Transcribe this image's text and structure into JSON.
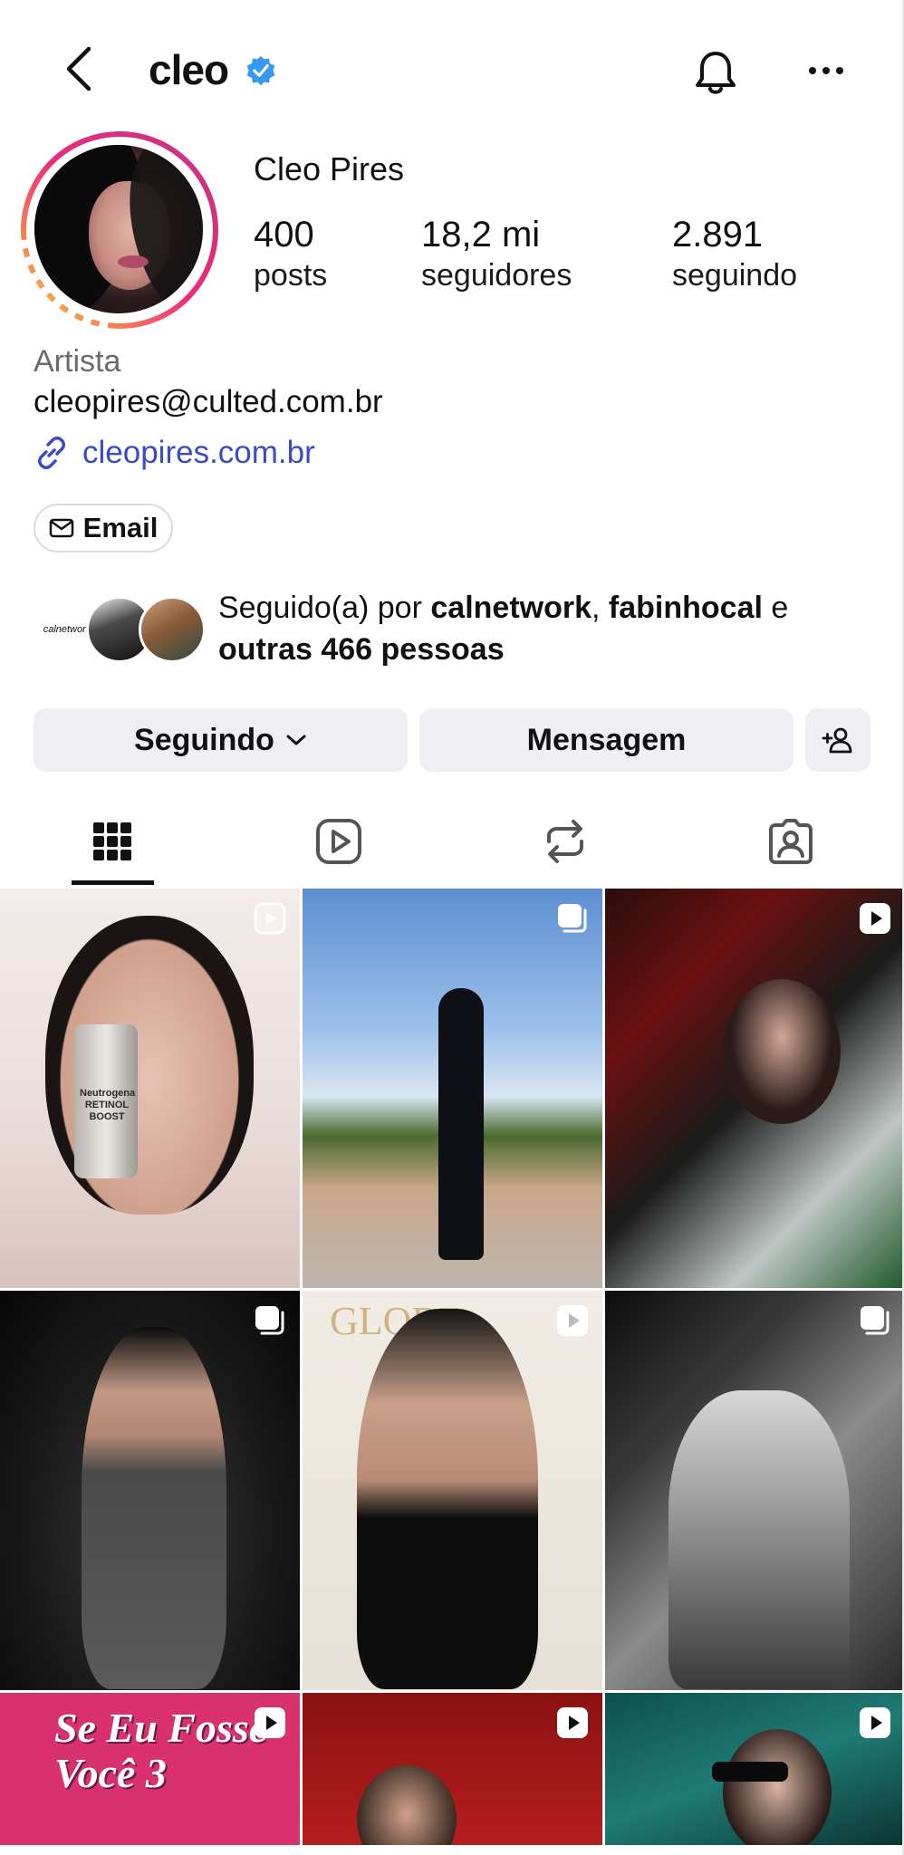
{
  "header": {
    "username": "cleo",
    "icons": {
      "back": "chevron-left-icon",
      "verified": "verified-badge-icon",
      "notifications": "bell-icon",
      "more": "ellipsis-icon"
    },
    "accent_color": "#3897f0"
  },
  "profile": {
    "full_name": "Cleo Pires",
    "stats": [
      {
        "value": "400",
        "label": "posts"
      },
      {
        "value": "18,2 mi",
        "label": "seguidores"
      },
      {
        "value": "2.891",
        "label": "seguindo"
      }
    ],
    "category": "Artista",
    "email": "cleopires@culted.com.br",
    "link": "cleopires.com.br",
    "link_color": "#3b4bc4",
    "email_button_label": "Email",
    "story_ring_colors": [
      "#f9ce34",
      "#ee2a7b",
      "#6228d7"
    ]
  },
  "followed_by": {
    "prefix": "Seguido(a) por ",
    "user1": "calnetwork",
    "separator": ", ",
    "user2": "fabinhocal",
    "conjunction": " e ",
    "others": "outras 466 pessoas",
    "avatar1_text": "calnetwork"
  },
  "actions": {
    "following_label": "Seguindo",
    "message_label": "Mensagem",
    "add_user_icon": "add-person-icon"
  },
  "tabs": [
    {
      "name": "grid",
      "icon": "grid-icon",
      "active": true
    },
    {
      "name": "reels",
      "icon": "reels-icon",
      "active": false
    },
    {
      "name": "reposts",
      "icon": "repost-icon",
      "active": false
    },
    {
      "name": "tagged",
      "icon": "tagged-icon",
      "active": false
    }
  ],
  "grid": {
    "posts": [
      {
        "badge": "reel",
        "caption_text": "Neutrogena RETINOL BOOST"
      },
      {
        "badge": "carousel"
      },
      {
        "badge": "reel"
      },
      {
        "badge": "carousel"
      },
      {
        "badge": "reel",
        "caption_text": "GLOBE"
      },
      {
        "badge": "carousel"
      },
      {
        "badge": "reel",
        "caption_text": "Se Eu Fosse Você 3"
      },
      {
        "badge": "reel"
      },
      {
        "badge": "reel"
      }
    ]
  }
}
